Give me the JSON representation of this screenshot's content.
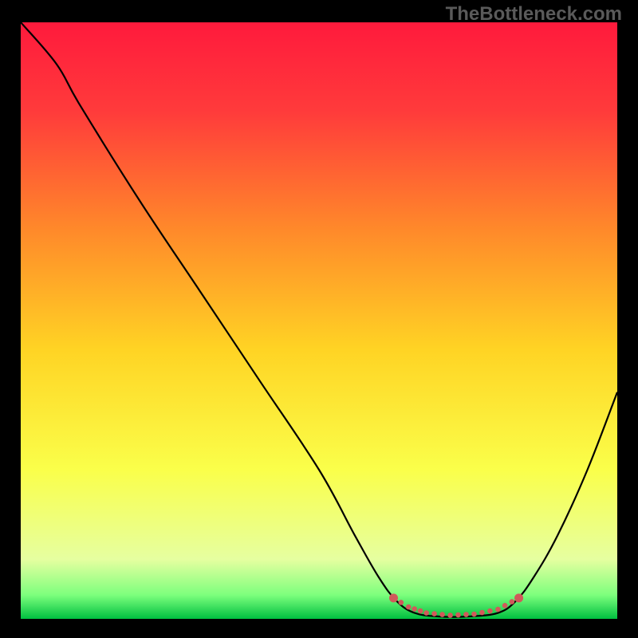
{
  "watermark": "TheBottleneck.com",
  "chart_data": {
    "type": "line",
    "title": "",
    "xlabel": "",
    "ylabel": "",
    "xlim": [
      0,
      100
    ],
    "ylim": [
      0,
      100
    ],
    "grid": false,
    "legend": false,
    "series": [
      {
        "name": "curve",
        "style": "solid",
        "color": "#000000",
        "points": [
          {
            "x": 0.0,
            "y": 100.0
          },
          {
            "x": 6.0,
            "y": 93.0
          },
          {
            "x": 10.0,
            "y": 86.0
          },
          {
            "x": 20.0,
            "y": 70.0
          },
          {
            "x": 30.0,
            "y": 55.0
          },
          {
            "x": 40.0,
            "y": 40.0
          },
          {
            "x": 50.0,
            "y": 25.0
          },
          {
            "x": 56.0,
            "y": 14.0
          },
          {
            "x": 60.0,
            "y": 7.0
          },
          {
            "x": 63.0,
            "y": 3.0
          },
          {
            "x": 66.0,
            "y": 1.0
          },
          {
            "x": 70.0,
            "y": 0.4
          },
          {
            "x": 75.0,
            "y": 0.4
          },
          {
            "x": 80.0,
            "y": 1.0
          },
          {
            "x": 83.0,
            "y": 3.0
          },
          {
            "x": 86.0,
            "y": 7.0
          },
          {
            "x": 90.0,
            "y": 14.0
          },
          {
            "x": 95.0,
            "y": 25.0
          },
          {
            "x": 100.0,
            "y": 38.0
          }
        ]
      },
      {
        "name": "highlight-segment",
        "style": "dotted",
        "color": "#d05a5a",
        "points": [
          {
            "x": 62.5,
            "y": 3.5
          },
          {
            "x": 65.0,
            "y": 2.0
          },
          {
            "x": 68.0,
            "y": 1.0
          },
          {
            "x": 72.0,
            "y": 0.6
          },
          {
            "x": 76.0,
            "y": 0.8
          },
          {
            "x": 80.0,
            "y": 1.6
          },
          {
            "x": 83.5,
            "y": 3.5
          }
        ]
      }
    ],
    "gradient_stops": [
      {
        "offset": 0.0,
        "color": "#ff1a3c"
      },
      {
        "offset": 0.15,
        "color": "#ff3b3b"
      },
      {
        "offset": 0.35,
        "color": "#ff8a2a"
      },
      {
        "offset": 0.55,
        "color": "#ffd424"
      },
      {
        "offset": 0.75,
        "color": "#faff4a"
      },
      {
        "offset": 0.9,
        "color": "#e6ffa0"
      },
      {
        "offset": 0.96,
        "color": "#7dff7d"
      },
      {
        "offset": 1.0,
        "color": "#00c040"
      }
    ]
  }
}
